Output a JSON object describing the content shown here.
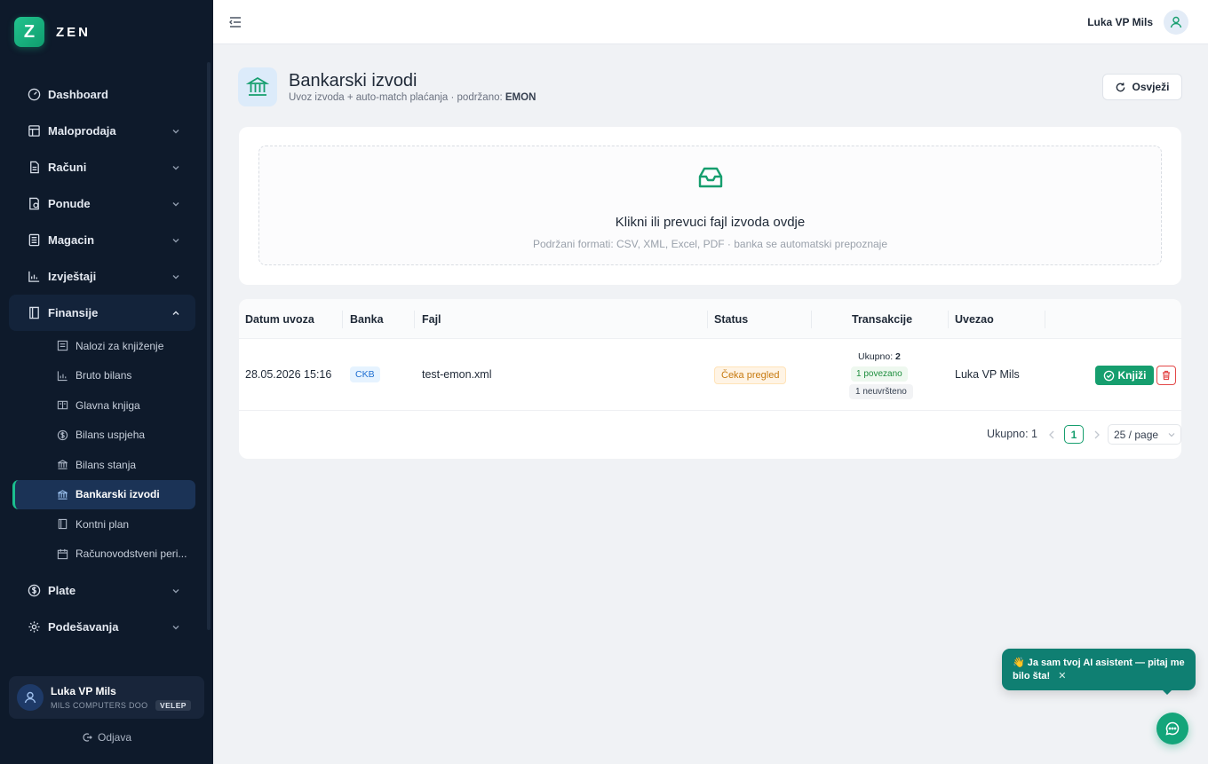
{
  "app": {
    "logo_letter": "Z",
    "name": "ZEN"
  },
  "sidebar": {
    "items": [
      {
        "label": "Dashboard",
        "icon": "gauge-icon"
      },
      {
        "label": "Maloprodaja",
        "icon": "store-icon"
      },
      {
        "label": "Računi",
        "icon": "document-icon"
      },
      {
        "label": "Ponude",
        "icon": "offer-icon"
      },
      {
        "label": "Magacin",
        "icon": "warehouse-icon"
      },
      {
        "label": "Izvještaji",
        "icon": "chart-icon"
      },
      {
        "label": "Finansije",
        "icon": "book-icon"
      },
      {
        "label": "Plate",
        "icon": "dollar-icon"
      },
      {
        "label": "Podešavanja",
        "icon": "gear-icon"
      }
    ],
    "finansije_sub": [
      "Nalozi za knjiženje",
      "Bruto bilans",
      "Glavna knjiga",
      "Bilans uspjeha",
      "Bilans stanja",
      "Bankarski izvodi",
      "Kontni plan",
      "Računovodstveni peri..."
    ],
    "user": {
      "name": "Luka VP Mils",
      "org": "MILS COMPUTERS DOO",
      "badge": "VELEP"
    },
    "logout": "Odjava"
  },
  "header": {
    "user_name": "Luka VP Mils"
  },
  "page": {
    "title": "Bankarski izvodi",
    "subtitle_prefix": "Uvoz izvoda + auto-match plaćanja · podržano: ",
    "subtitle_bold": "EMON",
    "refresh_label": "Osvježi"
  },
  "upload": {
    "title": "Klikni ili prevuci fajl izvoda ovdje",
    "hint": "Podržani formati: CSV, XML, Excel, PDF · banka se automatski prepoznaje"
  },
  "table": {
    "columns": [
      "Datum uvoza",
      "Banka",
      "Fajl",
      "Status",
      "Transakcije",
      "Uvezao"
    ],
    "rows": [
      {
        "date": "28.05.2026 15:16",
        "bank": "CKB",
        "file": "test-emon.xml",
        "status": "Čeka pregled",
        "tx_total_label": "Ukupno: ",
        "tx_total": "2",
        "tx_linked": "1 povezano",
        "tx_unmapped": "1 neuvršteno",
        "imported_by": "Luka VP Mils",
        "post_label": "Knjiži"
      }
    ]
  },
  "pagination": {
    "total": "Ukupno: 1",
    "current_page": "1",
    "page_size": "25 / page"
  },
  "assistant": {
    "emoji": "👋",
    "message": "Ja sam tvoj AI asistent — pitaj me bilo šta!",
    "close": "✕"
  },
  "colors": {
    "accent": "#169e6e",
    "sidebar_bg": "#0e1a2b",
    "danger": "#e34848"
  }
}
